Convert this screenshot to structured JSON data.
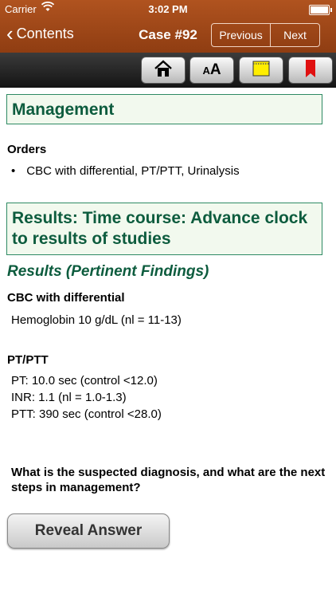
{
  "status": {
    "carrier": "Carrier",
    "time": "3:02 PM"
  },
  "nav": {
    "back_label": "Contents",
    "title": "Case #92",
    "previous_label": "Previous",
    "next_label": "Next"
  },
  "toolbar": {
    "buttons": [
      "home-icon",
      "font-size-icon",
      "note-icon",
      "bookmark-icon"
    ]
  },
  "sections": {
    "management": "Management",
    "results_title": "Results: Time course: Advance clock to results of studies"
  },
  "orders": {
    "title": "Orders",
    "items": [
      "CBC with differential, PT/PTT, Urinalysis"
    ]
  },
  "results": {
    "subheading": "Results (Pertinent Findings)",
    "cbc_title": "CBC with differential",
    "cbc_lines": [
      "Hemoglobin 10 g/dL (nl = 11-13)"
    ],
    "pt_title": "PT/PTT",
    "pt_lines": [
      "PT: 10.0 sec (control <12.0)",
      "INR: 1.1 (nl = 1.0-1.3)",
      "PTT: 390 sec (control <28.0)"
    ]
  },
  "question": "What is the suspected diagnosis, and what are the next steps in management?",
  "reveal_label": "Reveal Answer",
  "colors": {
    "nav_brown": "#9c4517",
    "section_green": "#0d5c3e",
    "note_yellow": "#ffee00",
    "bookmark_red": "#e01010"
  }
}
